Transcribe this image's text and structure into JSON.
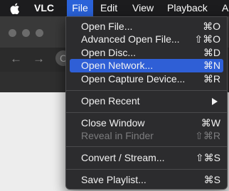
{
  "menubar": {
    "app_name": "VLC",
    "menus": [
      "File",
      "Edit",
      "View",
      "Playback",
      "A"
    ]
  },
  "browser": {
    "back_glyph": "←",
    "forward_glyph": "→",
    "reload_glyph": "C"
  },
  "file_menu": {
    "items": [
      {
        "label": "Open File...",
        "shortcut": "⌘O"
      },
      {
        "label": "Advanced Open File...",
        "shortcut": "⇧⌘O"
      },
      {
        "label": "Open Disc...",
        "shortcut": "⌘D"
      },
      {
        "label": "Open Network...",
        "shortcut": "⌘N",
        "highlighted": true
      },
      {
        "label": "Open Capture Device...",
        "shortcut": "⌘R"
      },
      {
        "label": "Open Recent",
        "submenu": true
      },
      {
        "label": "Close Window",
        "shortcut": "⌘W"
      },
      {
        "label": "Reveal in Finder",
        "shortcut": "⇧⌘R",
        "disabled": true
      },
      {
        "label": "Convert / Stream...",
        "shortcut": "⇧⌘S"
      },
      {
        "label": "Save Playlist...",
        "shortcut": "⌘S"
      }
    ]
  },
  "colors": {
    "menubar_bg": "#1c1c1e",
    "highlight": "#2f5fd6",
    "menu_bg": "#2c2c2e"
  }
}
